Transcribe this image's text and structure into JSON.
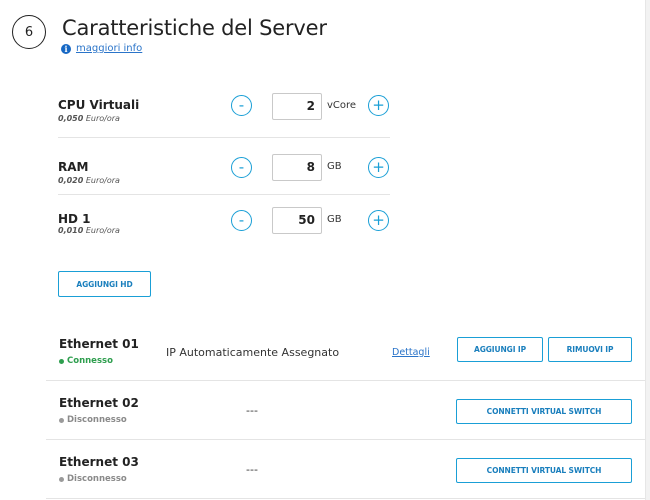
{
  "section": {
    "step_number": "6",
    "title": "Caratteristiche del Server",
    "info_link": "maggiori info"
  },
  "resources": [
    {
      "name": "CPU Virtuali",
      "price": "0,050",
      "price_unit": "Euro/ora",
      "value": "2",
      "unit": "vCore",
      "minus": "-",
      "plus": "+"
    },
    {
      "name": "RAM",
      "price": "0,020",
      "price_unit": "Euro/ora",
      "value": "8",
      "unit": "GB",
      "minus": "-",
      "plus": "+"
    },
    {
      "name": "HD 1",
      "price": "0,010",
      "price_unit": "Euro/ora",
      "value": "50",
      "unit": "GB",
      "minus": "-",
      "plus": "+"
    }
  ],
  "add_hd_label": "AGGIUNGI HD",
  "ethernet": [
    {
      "name": "Ethernet 01",
      "status": "Connesso",
      "ip": "IP Automaticamente Assegnato",
      "details": "Dettagli",
      "add_ip": "AGGIUNGI IP",
      "remove_ip": "RIMUOVI IP"
    },
    {
      "name": "Ethernet 02",
      "status": "Disconnesso",
      "ip": "---",
      "connect": "CONNETTI VIRTUAL SWITCH"
    },
    {
      "name": "Ethernet 03",
      "status": "Disconnesso",
      "ip": "---",
      "connect": "CONNETTI VIRTUAL SWITCH"
    }
  ],
  "colors": {
    "accent": "#1a9fd6",
    "link": "#2a74c9",
    "connected": "#2e9e4e",
    "disconnected": "#8a8a8a"
  },
  "icons": {
    "info": "info-icon"
  }
}
